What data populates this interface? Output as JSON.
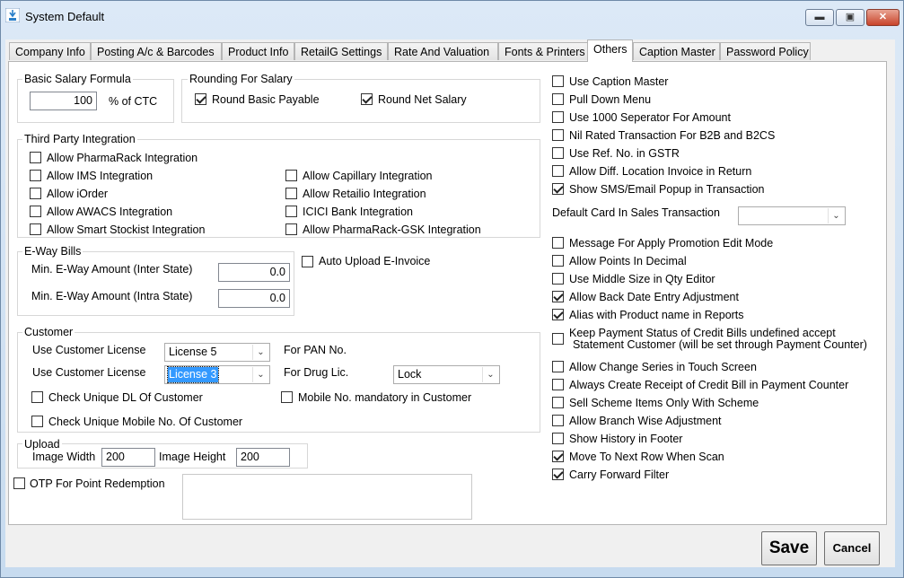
{
  "window": {
    "title": "System Default",
    "minimize_symbol": "▬",
    "maximize_symbol": "▣",
    "close_symbol": "✕"
  },
  "tabs": [
    "Company Info",
    "Posting A/c & Barcodes",
    "Product Info",
    "RetailG Settings",
    "Rate And Valuation",
    "Fonts & Printers",
    "Others",
    "Caption Master",
    "Password Policy"
  ],
  "active_tab": "Others",
  "salary": {
    "basic_group": "Basic Salary Formula",
    "basic_value": "100",
    "basic_suffix": "% of CTC",
    "rounding_group": "Rounding For Salary",
    "round_basic": {
      "label": "Round Basic Payable",
      "checked": true
    },
    "round_net": {
      "label": "Round Net Salary",
      "checked": true
    }
  },
  "third_party": {
    "group": "Third Party Integration",
    "items": [
      {
        "label": "Allow PharmaRack Integration",
        "checked": false
      },
      {
        "label": "Allow IMS Integration",
        "checked": false
      },
      {
        "label": "Allow iOrder",
        "checked": false
      },
      {
        "label": "Allow AWACS Integration",
        "checked": false
      },
      {
        "label": "Allow Smart Stockist Integration",
        "checked": false
      },
      {
        "label": "Allow Capillary Integration",
        "checked": false
      },
      {
        "label": "Allow Retailio Integration",
        "checked": false
      },
      {
        "label": "ICICI Bank Integration",
        "checked": false
      },
      {
        "label": "Allow PharmaRack-GSK Integration",
        "checked": false
      }
    ]
  },
  "eway": {
    "group": "E-Way Bills",
    "inter_label": "Min. E-Way Amount (Inter State)",
    "inter_value": "0.0",
    "intra_label": "Min. E-Way Amount (Intra State)",
    "intra_value": "0.0",
    "auto_upload": {
      "label": "Auto Upload E-Invoice",
      "checked": false
    }
  },
  "customer": {
    "group": "Customer",
    "pan_label": "Use Customer License",
    "pan_value": "License 5",
    "pan_for": "For PAN No.",
    "drug_label": "Use Customer License",
    "drug_value": "License 3",
    "drug_for": "For Drug Lic.",
    "drug_action": "Lock",
    "unique_dl": {
      "label": "Check Unique DL Of Customer",
      "checked": false
    },
    "mobile_mandatory": {
      "label": "Mobile No. mandatory in Customer",
      "checked": false
    },
    "unique_mobile": {
      "label": "Check Unique Mobile No. Of Customer",
      "checked": false
    }
  },
  "upload": {
    "group": "Upload",
    "width_label": "Image Width",
    "width_value": "200",
    "height_label": "Image Height",
    "height_value": "200"
  },
  "otp": {
    "label": "OTP For Point Redemption",
    "checked": false
  },
  "right_options_top": [
    {
      "label": "Use Caption Master",
      "checked": false
    },
    {
      "label": "Pull Down Menu",
      "checked": false
    },
    {
      "label": "Use 1000 Seperator For Amount",
      "checked": false
    },
    {
      "label": "Nil Rated Transaction For B2B and B2CS",
      "checked": false
    },
    {
      "label": "Use Ref. No. in GSTR",
      "checked": false
    },
    {
      "label": "Allow Diff. Location Invoice in Return",
      "checked": false
    },
    {
      "label": "Show SMS/Email Popup in Transaction",
      "checked": true
    }
  ],
  "default_card": {
    "label": "Default Card In Sales Transaction",
    "value": ""
  },
  "right_options_mid": [
    {
      "label": "Message For Apply Promotion Edit Mode",
      "checked": false
    },
    {
      "label": "Allow Points In Decimal",
      "checked": false
    },
    {
      "label": "Use Middle Size in Qty Editor",
      "checked": false
    },
    {
      "label": "Allow Back Date Entry Adjustment",
      "checked": true
    },
    {
      "label": "Alias with Product name in Reports",
      "checked": true
    }
  ],
  "keep_payment": {
    "line1": "Keep Payment Status of Credit Bills undefined accept",
    "line2": "Statement Customer (will be set through Payment Counter)",
    "checked": false
  },
  "right_options_bottom": [
    {
      "label": "Allow Change Series in Touch Screen",
      "checked": false
    },
    {
      "label": "Always Create Receipt of Credit Bill in Payment Counter",
      "checked": false
    },
    {
      "label": "Sell Scheme Items Only With Scheme",
      "checked": false
    },
    {
      "label": "Allow Branch Wise Adjustment",
      "checked": false
    },
    {
      "label": "Show History in Footer",
      "checked": false
    },
    {
      "label": "Move To Next Row When Scan",
      "checked": true
    },
    {
      "label": "Carry Forward Filter",
      "checked": true
    }
  ],
  "buttons": {
    "save": "Save",
    "cancel": "Cancel"
  }
}
